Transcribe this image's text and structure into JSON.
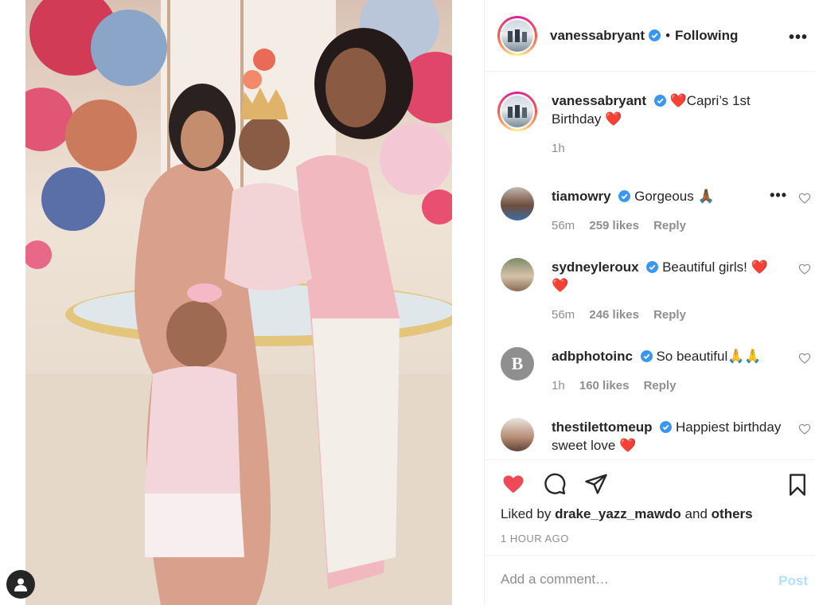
{
  "post": {
    "image_alt": "Family photo at birthday party with balloons",
    "author": "vanessabryant",
    "follow_state": "Following",
    "separator": "•",
    "more_icon": "more-horizontal-icon"
  },
  "caption": {
    "username": "vanessabryant",
    "text": "❤️Capri’s 1st Birthday ❤️",
    "time": "1h"
  },
  "comments": [
    {
      "username": "tiamowry",
      "text": "Gorgeous 🙏🏾",
      "time": "56m",
      "likes": "259 likes",
      "reply": "Reply"
    },
    {
      "username": "sydneyleroux",
      "text": "Beautiful girls! ❤️ ❤️",
      "time": "56m",
      "likes": "246 likes",
      "reply": "Reply"
    },
    {
      "username": "adbphotoinc",
      "text": "So beautiful🙏🙏",
      "time": "1h",
      "likes": "160 likes",
      "reply": "Reply"
    },
    {
      "username": "thestilettomeup",
      "text": "Happiest birthday sweet love ❤️",
      "time": "",
      "likes": "",
      "reply": ""
    }
  ],
  "actions": {
    "liked_prefix": "Liked by",
    "liked_user": "drake_yazz_mawdo",
    "liked_and": "and",
    "liked_others": "others",
    "timestamp": "1 HOUR AGO"
  },
  "add_comment": {
    "placeholder": "Add a comment…",
    "post_label": "Post"
  },
  "colors": {
    "heart_red": "#ed4956",
    "verified_blue": "#3897f0",
    "post_disabled": "#b2dffc"
  }
}
